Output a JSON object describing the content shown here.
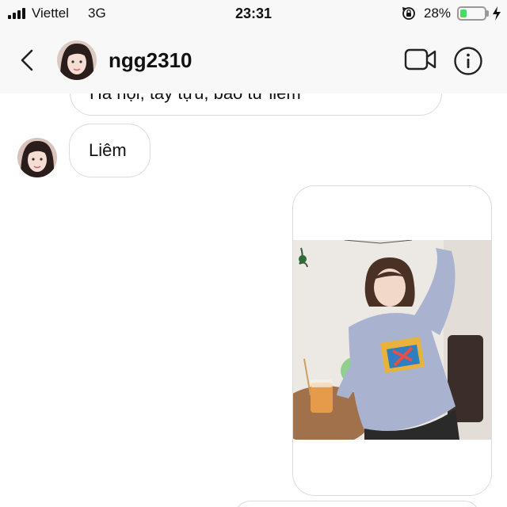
{
  "status_bar": {
    "carrier": "Viettel",
    "network": "3G",
    "time": "23:31",
    "battery_percent_label": "28%",
    "battery_level": 0.28,
    "icons": [
      "signal-icon",
      "rotation-lock-icon",
      "battery-icon",
      "charging-bolt-icon"
    ]
  },
  "header": {
    "username": "ngg2310",
    "icons": [
      "back-chevron-icon",
      "profile-avatar",
      "video-call-icon",
      "info-icon"
    ]
  },
  "messages": [
    {
      "sender": "ngg2310",
      "type": "text",
      "text": "Hà nội, tây tựu, bao từ liêm",
      "partially_visible": true
    },
    {
      "sender": "ngg2310",
      "type": "text",
      "text": "Liêm"
    },
    {
      "sender": "me",
      "type": "image"
    }
  ],
  "colors": {
    "bubble_border": "#dbdbdb",
    "header_bg": "#f8f8f8",
    "battery_fill": "#4cd964"
  }
}
